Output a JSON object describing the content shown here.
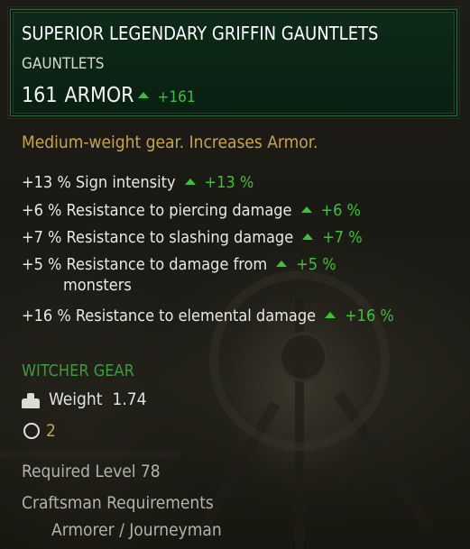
{
  "item": {
    "name": "SUPERIOR LEGENDARY GRIFFIN GAUNTLETS",
    "type": "GAUNTLETS",
    "armor_value": "161",
    "armor_label": "ARMOR",
    "armor_delta": "+161"
  },
  "description": "Medium-weight gear. Increases Armor.",
  "stats": [
    {
      "text": "+13 % Sign intensity",
      "delta": "+13 %"
    },
    {
      "text": "+6 % Resistance to piercing damage",
      "delta": "+6 %"
    },
    {
      "text": "+7 % Resistance to slashing damage",
      "delta": "+7 %"
    },
    {
      "text": "+5 % Resistance to damage from",
      "text_cont": "monsters",
      "delta": "+5 %"
    },
    {
      "text": "+16 % Resistance to elemental damage",
      "delta": "+16 %"
    }
  ],
  "set_label": "WITCHER GEAR",
  "weight": {
    "label": "Weight",
    "value": "1.74",
    "icon": "weight-icon"
  },
  "slots": {
    "count": "2",
    "icon": "slot-icon"
  },
  "required_level": "Required Level 78",
  "craftsman": {
    "label": "Craftsman Requirements",
    "value": "Armorer / Journeyman"
  },
  "colors": {
    "title": "#ffffff",
    "header_bg": "#0b2414",
    "header_border": "#2f6a3c",
    "positive": "#3ec13a",
    "description": "#c7a351",
    "set_label": "#3e9a3c",
    "muted": "#b3b3ac"
  },
  "icons": {
    "increase": "up-triangle-icon"
  }
}
